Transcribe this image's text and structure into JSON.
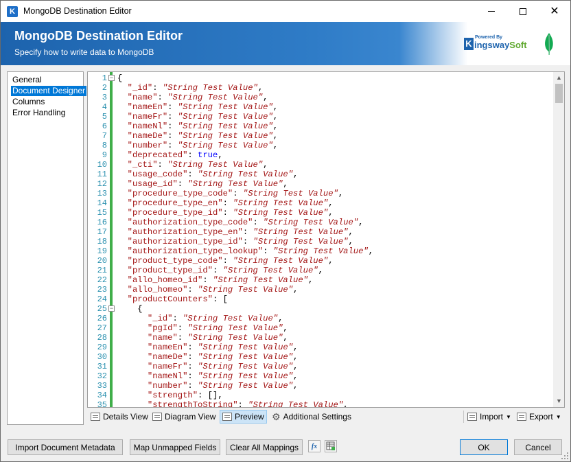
{
  "window": {
    "title": "MongoDB Destination Editor",
    "app_icon": "K"
  },
  "header": {
    "title": "MongoDB Destination Editor",
    "subtitle": "Specify how to write data to MongoDB",
    "logo_powered": "Powered By",
    "logo_k": "K",
    "logo_name_main": "ingsway",
    "logo_name_soft": "Soft"
  },
  "nav": {
    "items": [
      {
        "label": "General"
      },
      {
        "label": "Document Designer"
      },
      {
        "label": "Columns"
      },
      {
        "label": "Error Handling"
      }
    ],
    "selected_index": 1
  },
  "editor": {
    "lines": [
      {
        "n": "1",
        "indent": "",
        "key": "",
        "val": "",
        "type": "open",
        "text": "{"
      },
      {
        "n": "2",
        "indent": "  ",
        "key": "\"_id\"",
        "val": "\"String Test Value\"",
        "type": "str"
      },
      {
        "n": "3",
        "indent": "  ",
        "key": "\"name\"",
        "val": "\"String Test Value\"",
        "type": "str"
      },
      {
        "n": "4",
        "indent": "  ",
        "key": "\"nameEn\"",
        "val": "\"String Test Value\"",
        "type": "str"
      },
      {
        "n": "5",
        "indent": "  ",
        "key": "\"nameFr\"",
        "val": "\"String Test Value\"",
        "type": "str"
      },
      {
        "n": "6",
        "indent": "  ",
        "key": "\"nameNl\"",
        "val": "\"String Test Value\"",
        "type": "str"
      },
      {
        "n": "7",
        "indent": "  ",
        "key": "\"nameDe\"",
        "val": "\"String Test Value\"",
        "type": "str"
      },
      {
        "n": "8",
        "indent": "  ",
        "key": "\"number\"",
        "val": "\"String Test Value\"",
        "type": "str"
      },
      {
        "n": "9",
        "indent": "  ",
        "key": "\"deprecated\"",
        "val": "true",
        "type": "bool"
      },
      {
        "n": "10",
        "indent": "  ",
        "key": "\"_cti\"",
        "val": "\"String Test Value\"",
        "type": "str"
      },
      {
        "n": "11",
        "indent": "  ",
        "key": "\"usage_code\"",
        "val": "\"String Test Value\"",
        "type": "str"
      },
      {
        "n": "12",
        "indent": "  ",
        "key": "\"usage_id\"",
        "val": "\"String Test Value\"",
        "type": "str"
      },
      {
        "n": "13",
        "indent": "  ",
        "key": "\"procedure_type_code\"",
        "val": "\"String Test Value\"",
        "type": "str"
      },
      {
        "n": "14",
        "indent": "  ",
        "key": "\"procedure_type_en\"",
        "val": "\"String Test Value\"",
        "type": "str"
      },
      {
        "n": "15",
        "indent": "  ",
        "key": "\"procedure_type_id\"",
        "val": "\"String Test Value\"",
        "type": "str"
      },
      {
        "n": "16",
        "indent": "  ",
        "key": "\"authorization_type_code\"",
        "val": "\"String Test Value\"",
        "type": "str"
      },
      {
        "n": "17",
        "indent": "  ",
        "key": "\"authorization_type_en\"",
        "val": "\"String Test Value\"",
        "type": "str"
      },
      {
        "n": "18",
        "indent": "  ",
        "key": "\"authorization_type_id\"",
        "val": "\"String Test Value\"",
        "type": "str"
      },
      {
        "n": "19",
        "indent": "  ",
        "key": "\"authorization_type_lookup\"",
        "val": "\"String Test Value\"",
        "type": "str"
      },
      {
        "n": "20",
        "indent": "  ",
        "key": "\"product_type_code\"",
        "val": "\"String Test Value\"",
        "type": "str"
      },
      {
        "n": "21",
        "indent": "  ",
        "key": "\"product_type_id\"",
        "val": "\"String Test Value\"",
        "type": "str"
      },
      {
        "n": "22",
        "indent": "  ",
        "key": "\"allo_homeo_id\"",
        "val": "\"String Test Value\"",
        "type": "str"
      },
      {
        "n": "23",
        "indent": "  ",
        "key": "\"allo_homeo\"",
        "val": "\"String Test Value\"",
        "type": "str"
      },
      {
        "n": "24",
        "indent": "  ",
        "key": "\"productCounters\"",
        "val": "[",
        "type": "punct_open"
      },
      {
        "n": "25",
        "indent": "    ",
        "key": "",
        "val": "",
        "type": "open",
        "text": "{"
      },
      {
        "n": "26",
        "indent": "      ",
        "key": "\"_id\"",
        "val": "\"String Test Value\"",
        "type": "str"
      },
      {
        "n": "27",
        "indent": "      ",
        "key": "\"pgId\"",
        "val": "\"String Test Value\"",
        "type": "str"
      },
      {
        "n": "28",
        "indent": "      ",
        "key": "\"name\"",
        "val": "\"String Test Value\"",
        "type": "str"
      },
      {
        "n": "29",
        "indent": "      ",
        "key": "\"nameEn\"",
        "val": "\"String Test Value\"",
        "type": "str"
      },
      {
        "n": "30",
        "indent": "      ",
        "key": "\"nameDe\"",
        "val": "\"String Test Value\"",
        "type": "str"
      },
      {
        "n": "31",
        "indent": "      ",
        "key": "\"nameFr\"",
        "val": "\"String Test Value\"",
        "type": "str"
      },
      {
        "n": "32",
        "indent": "      ",
        "key": "\"nameNl\"",
        "val": "\"String Test Value\"",
        "type": "str"
      },
      {
        "n": "33",
        "indent": "      ",
        "key": "\"number\"",
        "val": "\"String Test Value\"",
        "type": "str"
      },
      {
        "n": "34",
        "indent": "      ",
        "key": "\"strength\"",
        "val": "[]",
        "type": "punct"
      },
      {
        "n": "35",
        "indent": "      ",
        "key": "\"strengthToString\"",
        "val": "\"String Test Value\"",
        "type": "str"
      }
    ],
    "folds": [
      "1",
      "25"
    ]
  },
  "tabs": {
    "details": "Details View",
    "diagram": "Diagram View",
    "preview": "Preview",
    "settings": "Additional Settings",
    "import": "Import",
    "export": "Export"
  },
  "buttons": {
    "import_metadata": "Import Document Metadata",
    "map_unmapped": "Map Unmapped Fields",
    "clear_mappings": "Clear All Mappings",
    "fx": "fx",
    "ok": "OK",
    "cancel": "Cancel"
  },
  "colors": {
    "banner_blue": "#1d63ad",
    "key_string": "#a31515",
    "boolean": "#0000ff",
    "line_number": "#2b91af",
    "gutter_green": "#3fae49",
    "selection": "#0078d7"
  }
}
